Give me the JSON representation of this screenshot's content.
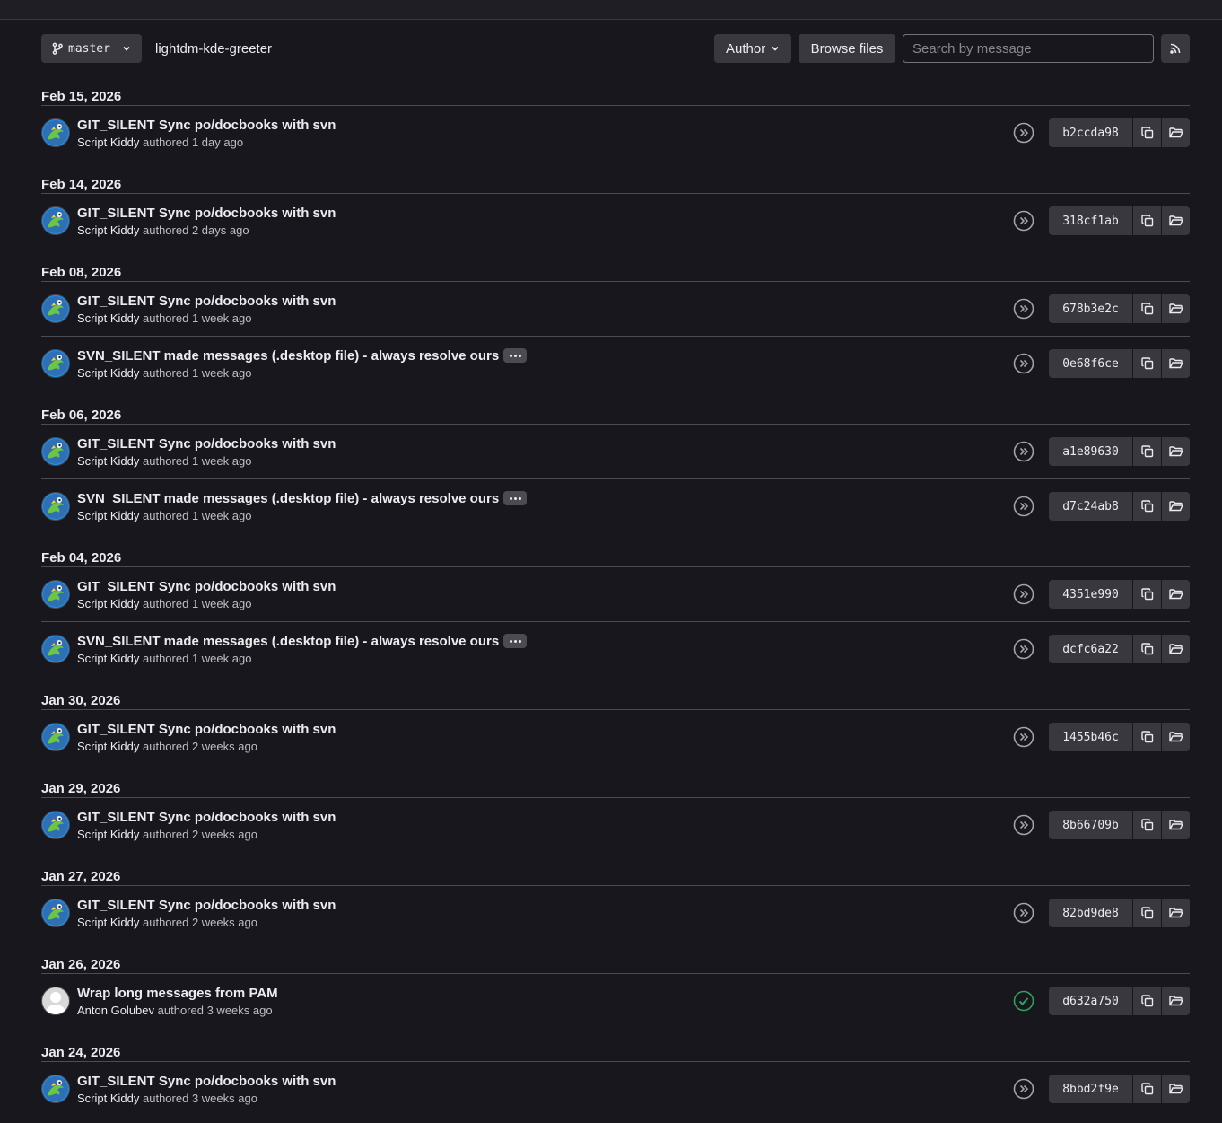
{
  "toolbar": {
    "branch": "master",
    "repo": "lightdm-kde-greeter",
    "author_label": "Author",
    "browse_label": "Browse files",
    "search_placeholder": "Search by message"
  },
  "groups": [
    {
      "date": "Feb 15, 2026",
      "commits": [
        {
          "title": "GIT_SILENT Sync po/docbooks with svn",
          "author": "Script Kiddy",
          "verb": "authored",
          "time": "1 day ago",
          "sha": "b2ccda98",
          "status": "skipped",
          "avatar": "kde",
          "has_more": false
        }
      ]
    },
    {
      "date": "Feb 14, 2026",
      "commits": [
        {
          "title": "GIT_SILENT Sync po/docbooks with svn",
          "author": "Script Kiddy",
          "verb": "authored",
          "time": "2 days ago",
          "sha": "318cf1ab",
          "status": "skipped",
          "avatar": "kde",
          "has_more": false
        }
      ]
    },
    {
      "date": "Feb 08, 2026",
      "commits": [
        {
          "title": "GIT_SILENT Sync po/docbooks with svn",
          "author": "Script Kiddy",
          "verb": "authored",
          "time": "1 week ago",
          "sha": "678b3e2c",
          "status": "skipped",
          "avatar": "kde",
          "has_more": false
        },
        {
          "title": "SVN_SILENT made messages (.desktop file) - always resolve ours",
          "author": "Script Kiddy",
          "verb": "authored",
          "time": "1 week ago",
          "sha": "0e68f6ce",
          "status": "skipped",
          "avatar": "kde",
          "has_more": true
        }
      ]
    },
    {
      "date": "Feb 06, 2026",
      "commits": [
        {
          "title": "GIT_SILENT Sync po/docbooks with svn",
          "author": "Script Kiddy",
          "verb": "authored",
          "time": "1 week ago",
          "sha": "a1e89630",
          "status": "skipped",
          "avatar": "kde",
          "has_more": false
        },
        {
          "title": "SVN_SILENT made messages (.desktop file) - always resolve ours",
          "author": "Script Kiddy",
          "verb": "authored",
          "time": "1 week ago",
          "sha": "d7c24ab8",
          "status": "skipped",
          "avatar": "kde",
          "has_more": true
        }
      ]
    },
    {
      "date": "Feb 04, 2026",
      "commits": [
        {
          "title": "GIT_SILENT Sync po/docbooks with svn",
          "author": "Script Kiddy",
          "verb": "authored",
          "time": "1 week ago",
          "sha": "4351e990",
          "status": "skipped",
          "avatar": "kde",
          "has_more": false
        },
        {
          "title": "SVN_SILENT made messages (.desktop file) - always resolve ours",
          "author": "Script Kiddy",
          "verb": "authored",
          "time": "1 week ago",
          "sha": "dcfc6a22",
          "status": "skipped",
          "avatar": "kde",
          "has_more": true
        }
      ]
    },
    {
      "date": "Jan 30, 2026",
      "commits": [
        {
          "title": "GIT_SILENT Sync po/docbooks with svn",
          "author": "Script Kiddy",
          "verb": "authored",
          "time": "2 weeks ago",
          "sha": "1455b46c",
          "status": "skipped",
          "avatar": "kde",
          "has_more": false
        }
      ]
    },
    {
      "date": "Jan 29, 2026",
      "commits": [
        {
          "title": "GIT_SILENT Sync po/docbooks with svn",
          "author": "Script Kiddy",
          "verb": "authored",
          "time": "2 weeks ago",
          "sha": "8b66709b",
          "status": "skipped",
          "avatar": "kde",
          "has_more": false
        }
      ]
    },
    {
      "date": "Jan 27, 2026",
      "commits": [
        {
          "title": "GIT_SILENT Sync po/docbooks with svn",
          "author": "Script Kiddy",
          "verb": "authored",
          "time": "2 weeks ago",
          "sha": "82bd9de8",
          "status": "skipped",
          "avatar": "kde",
          "has_more": false
        }
      ]
    },
    {
      "date": "Jan 26, 2026",
      "commits": [
        {
          "title": "Wrap long messages from PAM",
          "author": "Anton Golubev",
          "verb": "authored",
          "time": "3 weeks ago",
          "sha": "d632a750",
          "status": "passed",
          "avatar": "default",
          "has_more": false
        }
      ]
    },
    {
      "date": "Jan 24, 2026",
      "commits": [
        {
          "title": "GIT_SILENT Sync po/docbooks with svn",
          "author": "Script Kiddy",
          "verb": "authored",
          "time": "3 weeks ago",
          "sha": "8bbd2f9e",
          "status": "skipped",
          "avatar": "kde",
          "has_more": false
        }
      ]
    }
  ],
  "colors": {
    "background": "#18171d",
    "button": "#3a383f",
    "divider": "#4c4b51",
    "status_skipped": "#a4a3a8",
    "status_passed": "#2da160"
  },
  "icons": {
    "branch": "branch-icon",
    "chevron": "chevron-down-icon",
    "rss": "rss-icon",
    "skipped": "pipeline-skipped-icon",
    "passed": "pipeline-passed-icon",
    "copy": "copy-icon",
    "folder": "folder-icon",
    "more": "ellipsis-icon"
  }
}
